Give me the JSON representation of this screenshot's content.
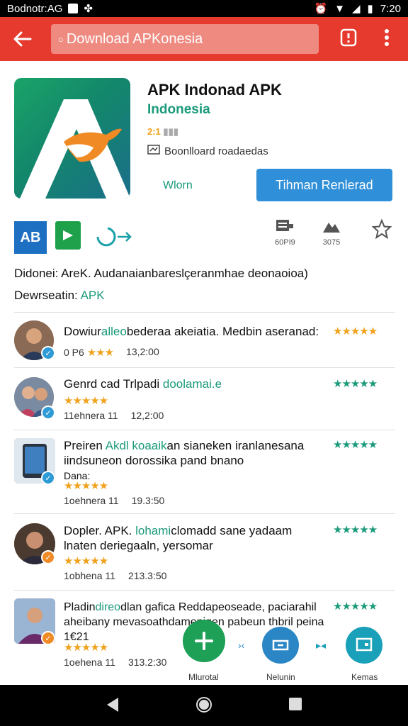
{
  "status_bar": {
    "left_text": "Bodnotr:AG",
    "time": "7:20"
  },
  "app_bar": {
    "search_text": "Download APKonesia",
    "icons": [
      "back-arrow-icon",
      "search-icon",
      "info-icon",
      "overflow-menu-icon"
    ]
  },
  "app": {
    "title": "APK Indonad APK",
    "developer": "Indonesia",
    "rating_text": "2:1",
    "downloads_text": "Boonlloard roadaedas",
    "more_label": "Wlorn",
    "install_label": "Tihman Renlerad"
  },
  "actions": {
    "left_icon_a_text": "AB",
    "right": [
      {
        "icon": "document-icon",
        "label": "60PI9"
      },
      {
        "icon": "mountain-icon",
        "label": "3075"
      },
      {
        "icon": "star-outline-icon",
        "label": ""
      }
    ]
  },
  "description": {
    "text": "Didonei: AreK. Audanaianbareslçeranmhae deonaoioa)",
    "dev_label": "Dewrseatin:",
    "dev_value": "APK"
  },
  "reviews": [
    {
      "title_pre": "Dowiur",
      "title_hl": "alleo",
      "title_post": "bederaa akeiatia. Medbin aseranad:",
      "line2": "",
      "meta_left": "0 P6",
      "meta_stars": "★★★",
      "meta_date": "13,2:00",
      "right_stars": "★★★★★",
      "badge_color": "#2f9bd6",
      "badge_icon": "check-icon"
    },
    {
      "title_pre": "Genrd cad Trlpadi",
      "title_hl": "doolamai.e",
      "title_post": "",
      "line2": "",
      "meta_left": "11ehnera 11",
      "meta_stars": "★★★★★",
      "meta_date": "12,2:00",
      "right_stars": "★★★★★",
      "badge_color": "#2f9bd6",
      "badge_icon": "check-icon"
    },
    {
      "title_pre": "Preiren",
      "title_hl": "Akdl koaaik",
      "title_post": "an sianeken iranlanesana",
      "line2": "iindsuneon dorossika pand bnano",
      "line3": "Dana:",
      "meta_left": "1oehnera 11",
      "meta_stars": "★★★★★",
      "meta_date": "19.3:50",
      "right_stars": "★★★★★",
      "badge_color": "#2f9bd6",
      "badge_icon": "check-icon"
    },
    {
      "title_pre": "Dopler. APK.",
      "title_hl": "lohami",
      "title_post": "clomadd sane yadaam",
      "line2": "lnaten deriegaaln, yersomar",
      "meta_left": "1obhena 11",
      "meta_stars": "★★★★★",
      "meta_date": "213.3:50",
      "right_stars": "★★★★★",
      "badge_color": "#f08a24",
      "badge_icon": "check-icon"
    },
    {
      "title_pre": "Pladin",
      "title_hl": "direo",
      "title_post": "dlan gafica Reddapeoseade, paciarahil",
      "line2": "aheibany mevasoathdamenigen pabeun thbril peina 1€21",
      "meta_left": "1oehena 11",
      "meta_stars": "★★★★★",
      "meta_date": "313.2:30",
      "right_stars": "★★★★★",
      "badge_color": "#f08a24",
      "badge_icon": "check-icon"
    }
  ],
  "fabs": [
    {
      "icon": "plus-icon",
      "label": "Mlurotal",
      "color": "#1fa057"
    },
    {
      "icon": "share-icon",
      "label": "Nelunin",
      "color": "#2b86c6"
    },
    {
      "icon": "window-icon",
      "label": "Kemas",
      "color": "#1aa0b8"
    }
  ],
  "nav_bar": {
    "icons": [
      "back-triangle-icon",
      "home-circle-icon",
      "recents-square-icon"
    ]
  }
}
